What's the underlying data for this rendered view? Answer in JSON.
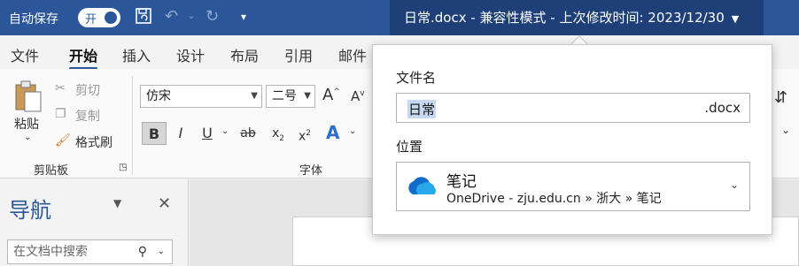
{
  "titlebar": {
    "autosave_label": "自动保存",
    "autosave_state": "开",
    "save_icon": "save-icon",
    "undo_icon": "undo-icon",
    "redo_icon": "redo-icon",
    "customize_icon": "chevron-down-icon",
    "doc_title": "日常.docx  -  兼容性模式  -  上次修改时间: 2023/12/30",
    "bg_color": "#2b579a"
  },
  "menu": {
    "items": [
      "文件",
      "开始",
      "插入",
      "设计",
      "布局",
      "引用",
      "邮件"
    ],
    "active": "开始"
  },
  "ribbon": {
    "clipboard": {
      "paste_label": "粘贴",
      "cut_label": "剪切",
      "copy_label": "复制",
      "format_painter_label": "格式刷",
      "group_label": "剪贴板"
    },
    "font": {
      "font_name": "仿宋",
      "font_size": "二号",
      "grow": "A",
      "shrink": "A",
      "bold": "B",
      "italic": "I",
      "underline": "U",
      "strike": "ab",
      "subscript": "x",
      "superscript": "x",
      "group_label": "字体"
    }
  },
  "nav": {
    "title": "导航",
    "search_placeholder": "在文档中搜索"
  },
  "popup": {
    "filename_label": "文件名",
    "filename_value": "日常",
    "extension": ".docx",
    "location_label": "位置",
    "location_name": "笔记",
    "location_path": "OneDrive - zju.edu.cn » 浙大 » 笔记"
  }
}
